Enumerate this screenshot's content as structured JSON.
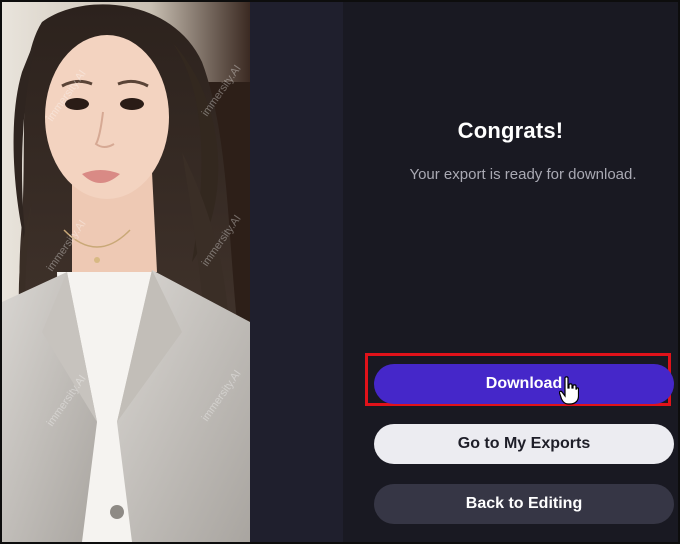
{
  "dialog": {
    "title": "Congrats!",
    "subtitle": "Your export is ready for download.",
    "buttons": {
      "download": "Download",
      "exports": "Go to My Exports",
      "back": "Back to Editing"
    }
  },
  "preview": {
    "watermark": "immersity.AI"
  },
  "colors": {
    "panel_bg": "#191922",
    "primary": "#4527c9",
    "highlight": "#e0121a",
    "light_button": "#ececf1",
    "dark_button": "#363645"
  }
}
